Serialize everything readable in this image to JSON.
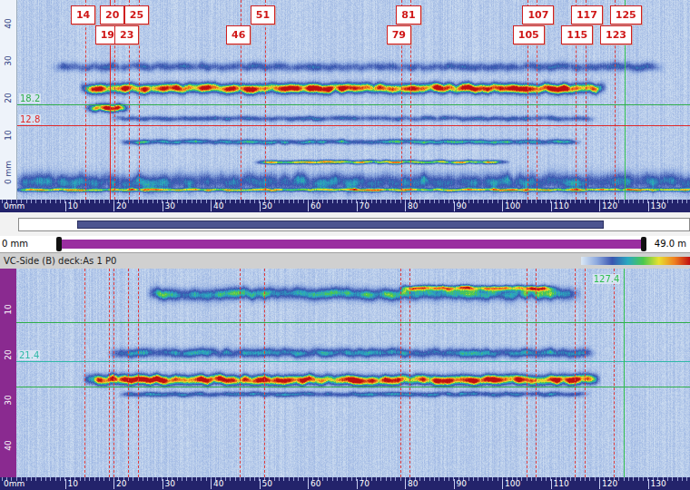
{
  "markers": [
    {
      "label": "14",
      "mm": 14
    },
    {
      "label": "19",
      "mm": 19
    },
    {
      "label": "20",
      "mm": 20
    },
    {
      "label": "23",
      "mm": 23
    },
    {
      "label": "25",
      "mm": 25
    },
    {
      "label": "46",
      "mm": 46
    },
    {
      "label": "51",
      "mm": 51
    },
    {
      "label": "79",
      "mm": 79
    },
    {
      "label": "81",
      "mm": 81
    },
    {
      "label": "105",
      "mm": 105
    },
    {
      "label": "107",
      "mm": 107
    },
    {
      "label": "115",
      "mm": 115
    },
    {
      "label": "117",
      "mm": 117
    },
    {
      "label": "123",
      "mm": 123
    },
    {
      "label": "125",
      "mm": 125
    }
  ],
  "top_scan": {
    "y_ticks": [
      {
        "label": "40",
        "mm": 40
      },
      {
        "label": "30",
        "mm": 30
      },
      {
        "label": "20",
        "mm": 20
      },
      {
        "label": "10",
        "mm": 10
      },
      {
        "label": "0 mm",
        "mm": 0
      }
    ],
    "x_ticks": [
      "0mm",
      "10",
      "20",
      "30",
      "40",
      "50",
      "60",
      "70",
      "80",
      "90",
      "100",
      "110",
      "120",
      "130"
    ],
    "cursors": [
      {
        "label": "18.2",
        "mm": 18.2,
        "color": "#2fae4a"
      },
      {
        "label": "12.8",
        "mm": 12.8,
        "color": "#e02828"
      }
    ],
    "v_cursor": {
      "mm": 19,
      "color": "#e02828"
    },
    "ref_line": {
      "mm": 125,
      "color": "#2fbf4f"
    },
    "indications": [
      {
        "x1": 14,
        "x2": 120,
        "depth": 22.7,
        "level": 1.0,
        "spread": 0.9
      },
      {
        "x1": 15,
        "x2": 22,
        "depth": 17.4,
        "level": 0.95,
        "spread": 0.7
      },
      {
        "x1": 8,
        "x2": 132,
        "depth": 28.5,
        "level": 0.32,
        "spread": 0.8
      },
      {
        "x1": 20,
        "x2": 118,
        "depth": 14.6,
        "level": 0.34,
        "spread": 0.5
      },
      {
        "x1": 22,
        "x2": 115,
        "depth": 8.3,
        "level": 0.5,
        "spread": 0.45
      },
      {
        "x1": 50,
        "x2": 100,
        "depth": 2.9,
        "level": 0.72,
        "spread": 0.35
      },
      {
        "x1": 0,
        "x2": 140,
        "depth": -2.5,
        "level": 0.42,
        "spread": 1.6
      },
      {
        "x1": 0,
        "x2": 140,
        "depth": -4.6,
        "level": 0.62,
        "spread": 0.3
      }
    ]
  },
  "overview": {
    "level": 0.86
  },
  "range_bar": {
    "start": "0 mm",
    "end": "49.0 m",
    "level": 1.0
  },
  "bottom_scan": {
    "title": "VC-Side (B) deck:As 1 P0",
    "y_ticks": [
      {
        "label": "10",
        "mm": 10
      },
      {
        "label": "20",
        "mm": 20
      },
      {
        "label": "30",
        "mm": 30
      },
      {
        "label": "40",
        "mm": 40
      }
    ],
    "x_ticks": [
      "0mm",
      "10",
      "20",
      "30",
      "40",
      "50",
      "60",
      "70",
      "80",
      "90",
      "100",
      "110",
      "120",
      "130"
    ],
    "cursors": [
      {
        "label": "",
        "mm": 12.8,
        "color": "#2fae4a"
      },
      {
        "label": "21.4",
        "mm": 21.4,
        "color": "#2fb8a8"
      },
      {
        "label": "",
        "mm": 27.0,
        "color": "#2fae4a"
      }
    ],
    "ref_line": {
      "mm": 125,
      "color": "#2fbf4f",
      "label": "127.4"
    },
    "indications": [
      {
        "x1": 15,
        "x2": 119,
        "depth": 25.4,
        "level": 1.0,
        "spread": 0.75
      },
      {
        "x1": 28,
        "x2": 115,
        "depth": 6.5,
        "level": 0.55,
        "spread": 0.9
      },
      {
        "x1": 80,
        "x2": 110,
        "depth": 5.2,
        "level": 0.72,
        "spread": 0.4
      },
      {
        "x1": 20,
        "x2": 118,
        "depth": 19.5,
        "level": 0.45,
        "spread": 0.7
      },
      {
        "x1": 22,
        "x2": 117,
        "depth": 28.6,
        "level": 0.4,
        "spread": 0.4
      }
    ]
  }
}
